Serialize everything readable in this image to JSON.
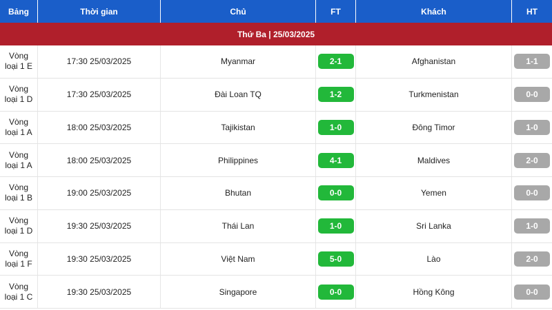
{
  "headers": {
    "group": "Bảng",
    "time": "Thời gian",
    "home": "Chủ",
    "ft": "FT",
    "away": "Khách",
    "ht": "HT"
  },
  "date_label": "Thứ Ba | 25/03/2025",
  "colors": {
    "header_bg": "#1a5ec9",
    "date_bg": "#b01f2b",
    "ft_badge": "#22b83a",
    "ht_badge": "#a8a8a8"
  },
  "matches": [
    {
      "group": "Vòng loại 1 E",
      "time": "17:30 25/03/2025",
      "home": "Myanmar",
      "ft": "2-1",
      "away": "Afghanistan",
      "ht": "1-1"
    },
    {
      "group": "Vòng loại 1 D",
      "time": "17:30 25/03/2025",
      "home": "Đài Loan TQ",
      "ft": "1-2",
      "away": "Turkmenistan",
      "ht": "0-0"
    },
    {
      "group": "Vòng loại 1 A",
      "time": "18:00 25/03/2025",
      "home": "Tajikistan",
      "ft": "1-0",
      "away": "Đông Timor",
      "ht": "1-0"
    },
    {
      "group": "Vòng loại 1 A",
      "time": "18:00 25/03/2025",
      "home": "Philippines",
      "ft": "4-1",
      "away": "Maldives",
      "ht": "2-0"
    },
    {
      "group": "Vòng loại 1 B",
      "time": "19:00 25/03/2025",
      "home": "Bhutan",
      "ft": "0-0",
      "away": "Yemen",
      "ht": "0-0"
    },
    {
      "group": "Vòng loại 1 D",
      "time": "19:30 25/03/2025",
      "home": "Thái Lan",
      "ft": "1-0",
      "away": "Sri Lanka",
      "ht": "1-0"
    },
    {
      "group": "Vòng loại 1 F",
      "time": "19:30 25/03/2025",
      "home": "Việt Nam",
      "ft": "5-0",
      "away": "Lào",
      "ht": "2-0"
    },
    {
      "group": "Vòng loại 1 C",
      "time": "19:30 25/03/2025",
      "home": "Singapore",
      "ft": "0-0",
      "away": "Hồng Kông",
      "ht": "0-0"
    }
  ]
}
